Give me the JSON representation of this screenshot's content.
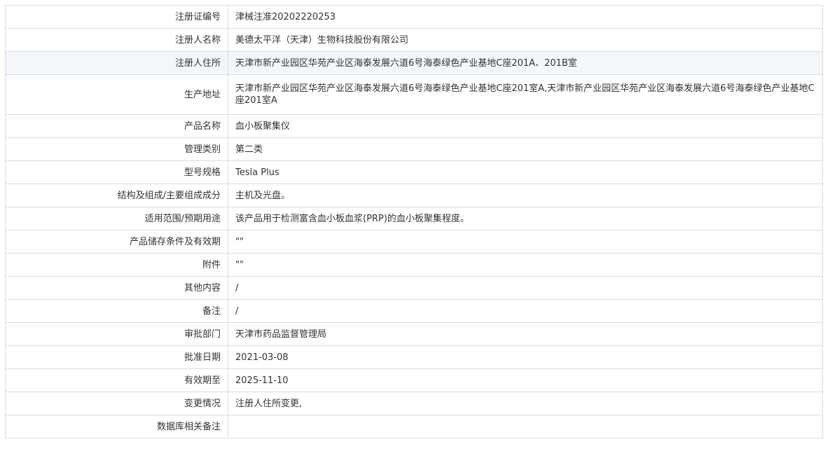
{
  "rows": [
    {
      "label": "注册证编号",
      "value": "津械注准20202220253"
    },
    {
      "label": "注册人名称",
      "value": "美德太平洋（天津）生物科技股份有限公司"
    },
    {
      "label": "注册人住所",
      "value": "天津市新产业园区华苑产业区海泰发展六道6号海泰绿色产业基地C座201A、201B室"
    },
    {
      "label": "生产地址",
      "value": "天津市新产业园区华苑产业区海泰发展六道6号海泰绿色产业基地C座201室A,天津市新产业园区华苑产业区海泰发展六道6号海泰绿色产业基地C座201室A"
    },
    {
      "label": "产品名称",
      "value": "血小板聚集仪"
    },
    {
      "label": "管理类别",
      "value": "第二类"
    },
    {
      "label": "型号规格",
      "value": "Tesla Plus"
    },
    {
      "label": "结构及组成/主要组成成分",
      "value": "主机及光盘。"
    },
    {
      "label": "适用范围/预期用途",
      "value": "该产品用于检测富含血小板血浆(PRP)的血小板聚集程度。"
    },
    {
      "label": "产品储存条件及有效期",
      "value": "\"\""
    },
    {
      "label": "附件",
      "value": "\"\""
    },
    {
      "label": "其他内容",
      "value": "/"
    },
    {
      "label": "备注",
      "value": "/"
    },
    {
      "label": "审批部门",
      "value": "天津市药品监督管理局"
    },
    {
      "label": "批准日期",
      "value": "2021-03-08"
    },
    {
      "label": "有效期至",
      "value": "2025-11-10"
    },
    {
      "label": "变更情况",
      "value": "注册人住所变更,"
    },
    {
      "label": "数据库相关备注",
      "value": ""
    }
  ]
}
